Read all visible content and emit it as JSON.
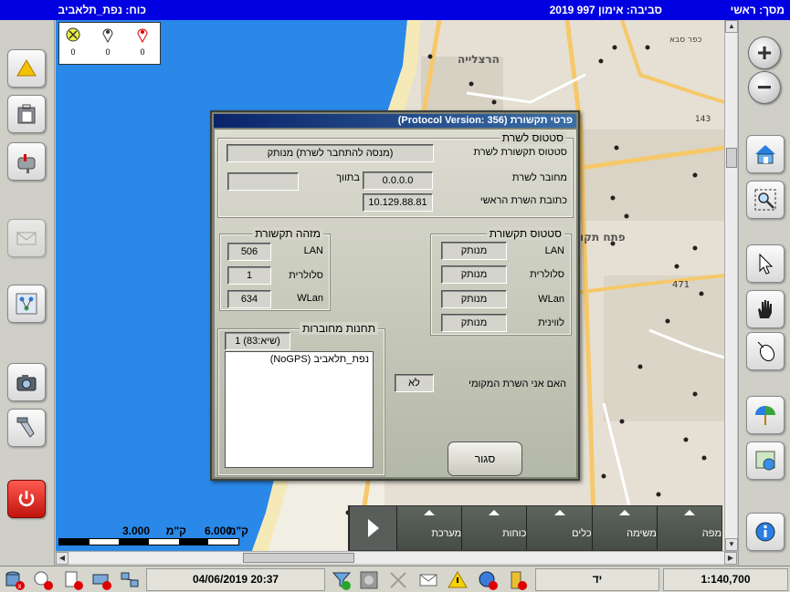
{
  "topbar": {
    "screen": "מסך: ראשי",
    "environment": "סביבה: אימון 997 2019",
    "force": "כוח: נפת_תלאביב"
  },
  "counters": [
    {
      "icon": "warning-circle-icon",
      "value": "0"
    },
    {
      "icon": "pin-gray-icon",
      "value": "0"
    },
    {
      "icon": "pin-red-icon",
      "value": "0"
    }
  ],
  "map": {
    "labels": {
      "herzliya": "הרצלייה",
      "petah_tikva": "פתח תקו",
      "route_471": "471",
      "route_143": "143",
      "kfar_saba": "כפר סבא"
    }
  },
  "scale": {
    "left_label": "3.000",
    "right_label": "6.000",
    "unit": "ק\"מ"
  },
  "menu": {
    "items": [
      "מפה",
      "משימה",
      "כלים",
      "כוחות",
      "מערכת"
    ]
  },
  "status": {
    "datetime": "04/06/2019 20:37",
    "mode": "יד",
    "zoom_scale": "1:140,700"
  },
  "dialog": {
    "title": "פרטי תקשורת (Protocol Version: 356)",
    "server_status": {
      "title": "סטטוס לשרת",
      "connection_label": "סטטוס תקשורת לשרת",
      "connection_value": "(מנסה להתחבר לשרת) מנותק",
      "connected_label": "מחובר לשרת",
      "connected_value": "0.0.0.0",
      "within_label": "בתווך",
      "within_value": "",
      "main_server_label": "כתובת השרת הראשי",
      "main_server_value": "10.129.88.81"
    },
    "comm_id": {
      "title": "מזהה תקשורת",
      "rows": [
        {
          "label": "LAN",
          "value": "506"
        },
        {
          "label": "סלולרית",
          "value": "1"
        },
        {
          "label": "WLan",
          "value": "634"
        }
      ]
    },
    "comm_status": {
      "title": "סטטוס תקשורת",
      "rows": [
        {
          "label": "LAN",
          "value": "מנותק"
        },
        {
          "label": "סלולרית",
          "value": "מנותק"
        },
        {
          "label": "WLan",
          "value": "מנותק"
        },
        {
          "label": "לווינית",
          "value": "מנותק"
        }
      ]
    },
    "stations": {
      "title": "תחנות מחוברות",
      "count": "(שיא:83) 1",
      "list": [
        "נפת_תלאביב (NoGPS)"
      ]
    },
    "local_server": {
      "label": "האם אני השרת המקומי",
      "value": "לא"
    },
    "close_label": "סגור"
  },
  "colors": {
    "title_blue": "#0000e0",
    "sea": "#2a88e8",
    "dialog_bg": "#d4d4c8"
  }
}
